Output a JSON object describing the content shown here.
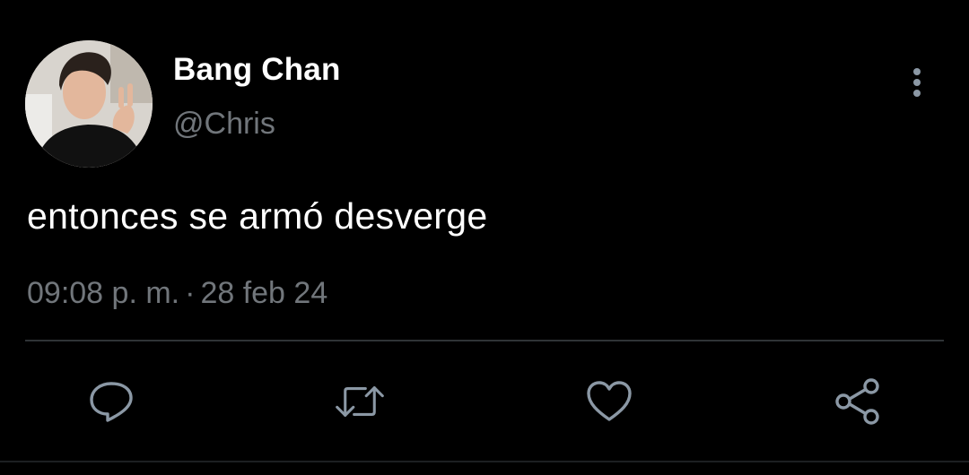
{
  "tweet": {
    "display_name": "Bang Chan",
    "handle": "@Chris",
    "text": "entonces se armó desverge",
    "time": "09:08 p. m.",
    "separator": "·",
    "date": "28 feb 24"
  },
  "icons": {
    "more": "more-vertical-icon",
    "reply": "reply-icon",
    "retweet": "retweet-icon",
    "like": "heart-icon",
    "share": "share-icon"
  },
  "colors": {
    "background": "#000000",
    "primary_text": "#ffffff",
    "secondary_text": "#71767b",
    "icon": "#8b98a5",
    "divider": "#2f3336"
  }
}
